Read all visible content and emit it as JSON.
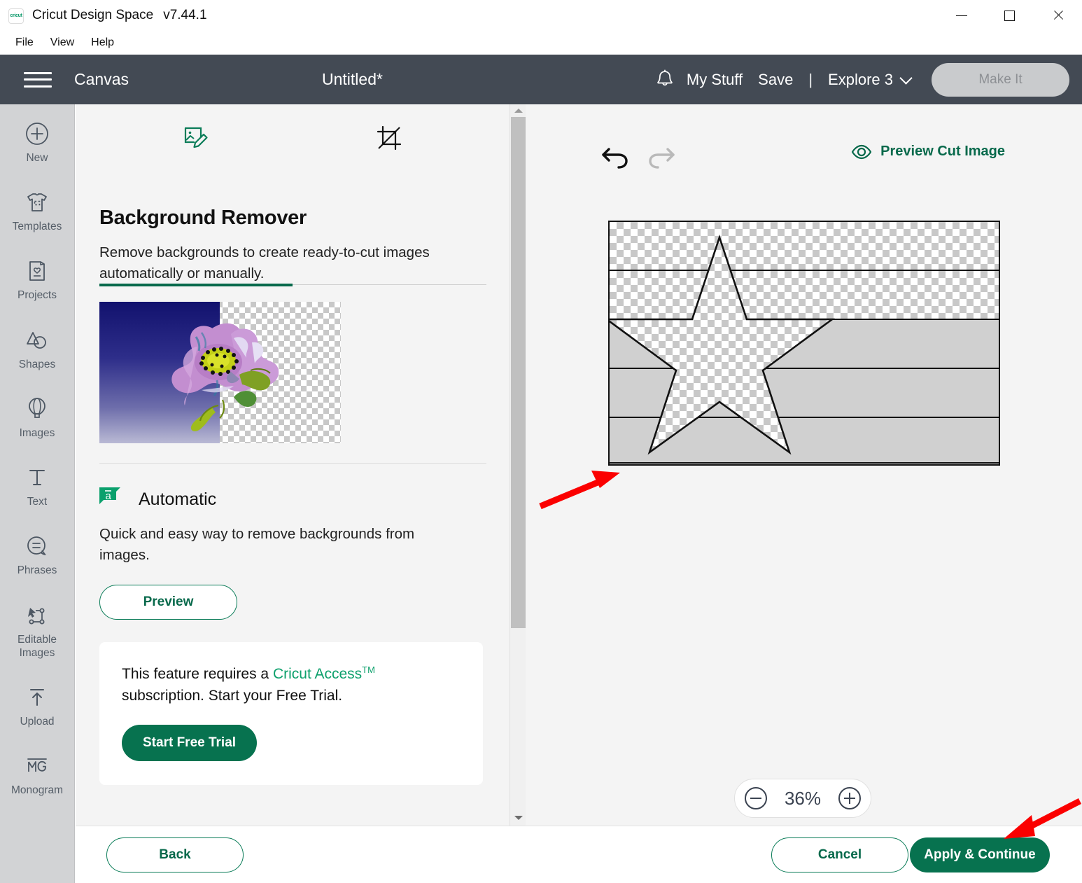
{
  "window": {
    "logo_text": "cricut",
    "title": "Cricut Design Space",
    "version": "v7.44.1",
    "minimize": "minimize-button",
    "maximize": "maximize-button",
    "close": "close-button"
  },
  "menubar": {
    "items": [
      "File",
      "View",
      "Help"
    ]
  },
  "navbar": {
    "canvas_label": "Canvas",
    "project_title": "Untitled*",
    "my_stuff": "My Stuff",
    "save": "Save",
    "separator": "|",
    "machine": "Explore 3",
    "make_it": "Make It",
    "bg_color": "#434a54"
  },
  "rail": {
    "items": [
      {
        "label": "New",
        "icon": "plus-circle-icon"
      },
      {
        "label": "Templates",
        "icon": "tshirt-icon"
      },
      {
        "label": "Projects",
        "icon": "card-heart-icon"
      },
      {
        "label": "Shapes",
        "icon": "shapes-icon"
      },
      {
        "label": "Images",
        "icon": "hot-air-balloon-icon"
      },
      {
        "label": "Text",
        "icon": "text-t-icon"
      },
      {
        "label": "Phrases",
        "icon": "speech-bubble-icon"
      },
      {
        "label": "Editable Images",
        "icon": "editable-images-icon"
      },
      {
        "label": "Upload",
        "icon": "upload-arrow-icon"
      },
      {
        "label": "Monogram",
        "icon": "monogram-icon"
      }
    ]
  },
  "panel": {
    "tabs": [
      {
        "name": "background-remover-tab",
        "icon": "image-edit-icon",
        "active": true
      },
      {
        "name": "crop-tab",
        "icon": "crop-icon",
        "active": false
      }
    ],
    "title": "Background Remover",
    "description": "Remove backgrounds to create ready-to-cut images automatically or manually.",
    "thumbnail_alt": "flower-before-after-thumbnail",
    "automatic": {
      "badge": "a",
      "label": "Automatic",
      "description": "Quick and easy way to remove backgrounds from images.",
      "preview_button": "Preview"
    },
    "access_card": {
      "text_part1": "This feature requires a ",
      "link": "Cricut Access",
      "tm": "TM",
      "text_part2": " subscription. Start your Free Trial.",
      "cta": "Start Free Trial"
    },
    "accent_color": "#07694b"
  },
  "canvas": {
    "undo": "undo-icon",
    "redo": "redo-icon",
    "preview_cut_image": "Preview Cut Image",
    "artwork": {
      "name": "flag-with-star-artwork",
      "stripes": [
        {
          "type": "transparent"
        },
        {
          "type": "transparent"
        },
        {
          "type": "solid"
        },
        {
          "type": "solid"
        },
        {
          "type": "solid"
        }
      ],
      "overlay": "star-outline"
    },
    "zoom": {
      "value": "36%",
      "minus": "zoom-out-button",
      "plus": "zoom-in-button"
    }
  },
  "bottombar": {
    "back": "Back",
    "cancel": "Cancel",
    "apply": "Apply & Continue"
  },
  "annotations": {
    "arrow_color": "#fb0000",
    "arrow_1": "points-at-artwork",
    "arrow_2": "points-at-apply-continue"
  }
}
